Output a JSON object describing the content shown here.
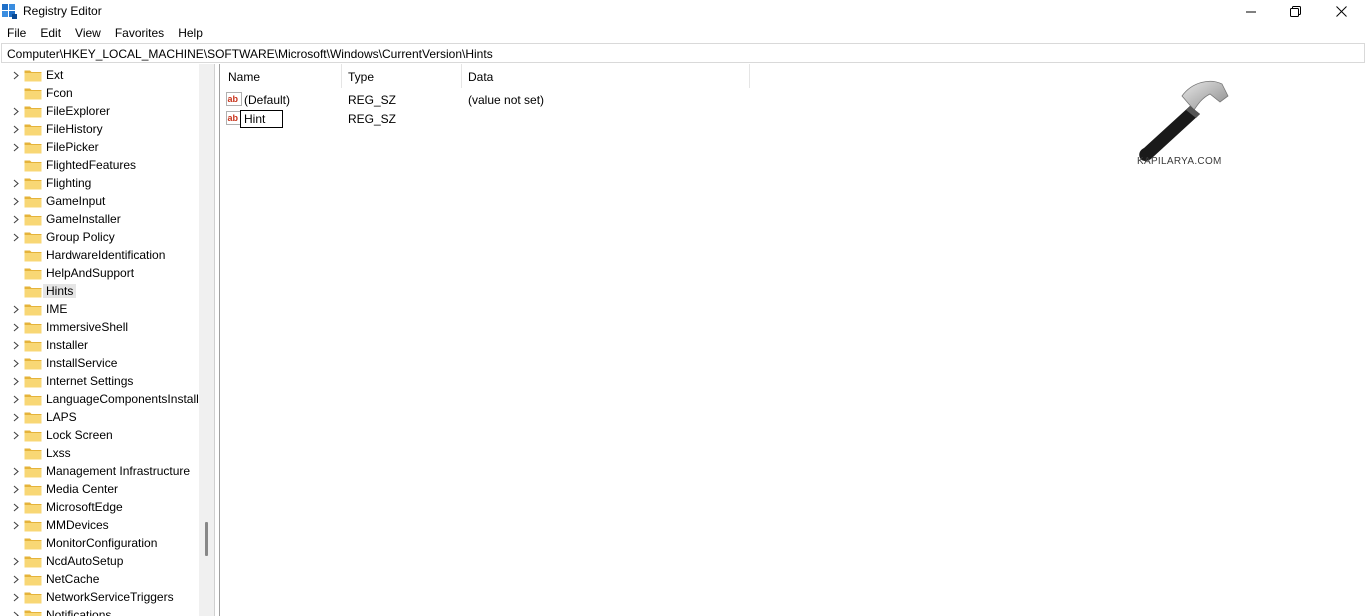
{
  "window": {
    "title": "Registry Editor"
  },
  "menu": [
    {
      "label": "File"
    },
    {
      "label": "Edit"
    },
    {
      "label": "View"
    },
    {
      "label": "Favorites"
    },
    {
      "label": "Help"
    }
  ],
  "address": {
    "path": "Computer\\HKEY_LOCAL_MACHINE\\SOFTWARE\\Microsoft\\Windows\\CurrentVersion\\Hints"
  },
  "tree": {
    "items": [
      {
        "label": "Ext",
        "expandable": true
      },
      {
        "label": "Fcon",
        "expandable": false
      },
      {
        "label": "FileExplorer",
        "expandable": true
      },
      {
        "label": "FileHistory",
        "expandable": true
      },
      {
        "label": "FilePicker",
        "expandable": true
      },
      {
        "label": "FlightedFeatures",
        "expandable": false
      },
      {
        "label": "Flighting",
        "expandable": true
      },
      {
        "label": "GameInput",
        "expandable": true
      },
      {
        "label": "GameInstaller",
        "expandable": true
      },
      {
        "label": "Group Policy",
        "expandable": true
      },
      {
        "label": "HardwareIdentification",
        "expandable": false
      },
      {
        "label": "HelpAndSupport",
        "expandable": false
      },
      {
        "label": "Hints",
        "expandable": false,
        "selected": true
      },
      {
        "label": "IME",
        "expandable": true
      },
      {
        "label": "ImmersiveShell",
        "expandable": true
      },
      {
        "label": "Installer",
        "expandable": true
      },
      {
        "label": "InstallService",
        "expandable": true
      },
      {
        "label": "Internet Settings",
        "expandable": true
      },
      {
        "label": "LanguageComponentsInstall",
        "expandable": true
      },
      {
        "label": "LAPS",
        "expandable": true
      },
      {
        "label": "Lock Screen",
        "expandable": true
      },
      {
        "label": "Lxss",
        "expandable": false
      },
      {
        "label": "Management Infrastructure",
        "expandable": true
      },
      {
        "label": "Media Center",
        "expandable": true
      },
      {
        "label": "MicrosoftEdge",
        "expandable": true
      },
      {
        "label": "MMDevices",
        "expandable": true
      },
      {
        "label": "MonitorConfiguration",
        "expandable": false
      },
      {
        "label": "NcdAutoSetup",
        "expandable": true
      },
      {
        "label": "NetCache",
        "expandable": true
      },
      {
        "label": "NetworkServiceTriggers",
        "expandable": true
      },
      {
        "label": "Notifications",
        "expandable": true
      }
    ]
  },
  "list": {
    "columns": {
      "name": "Name",
      "type": "Type",
      "data": "Data"
    },
    "rows": [
      {
        "name": "(Default)",
        "type": "REG_SZ",
        "data": "(value not set)"
      },
      {
        "name": "Hint",
        "type": "REG_SZ",
        "data": "",
        "renaming": true
      }
    ]
  },
  "watermark": {
    "text": "KAPILARYA.COM"
  },
  "colors": {
    "folder": "#f8d775",
    "folder_dark": "#e5b33a",
    "selection": "#e5e5e5"
  },
  "icons": {
    "app": "registry-editor-icon",
    "folder": "folder-icon",
    "expand": "chevron-right-icon",
    "string_value": "reg-sz-icon",
    "minimize": "minimize-icon",
    "restore": "restore-icon",
    "close": "close-icon"
  }
}
